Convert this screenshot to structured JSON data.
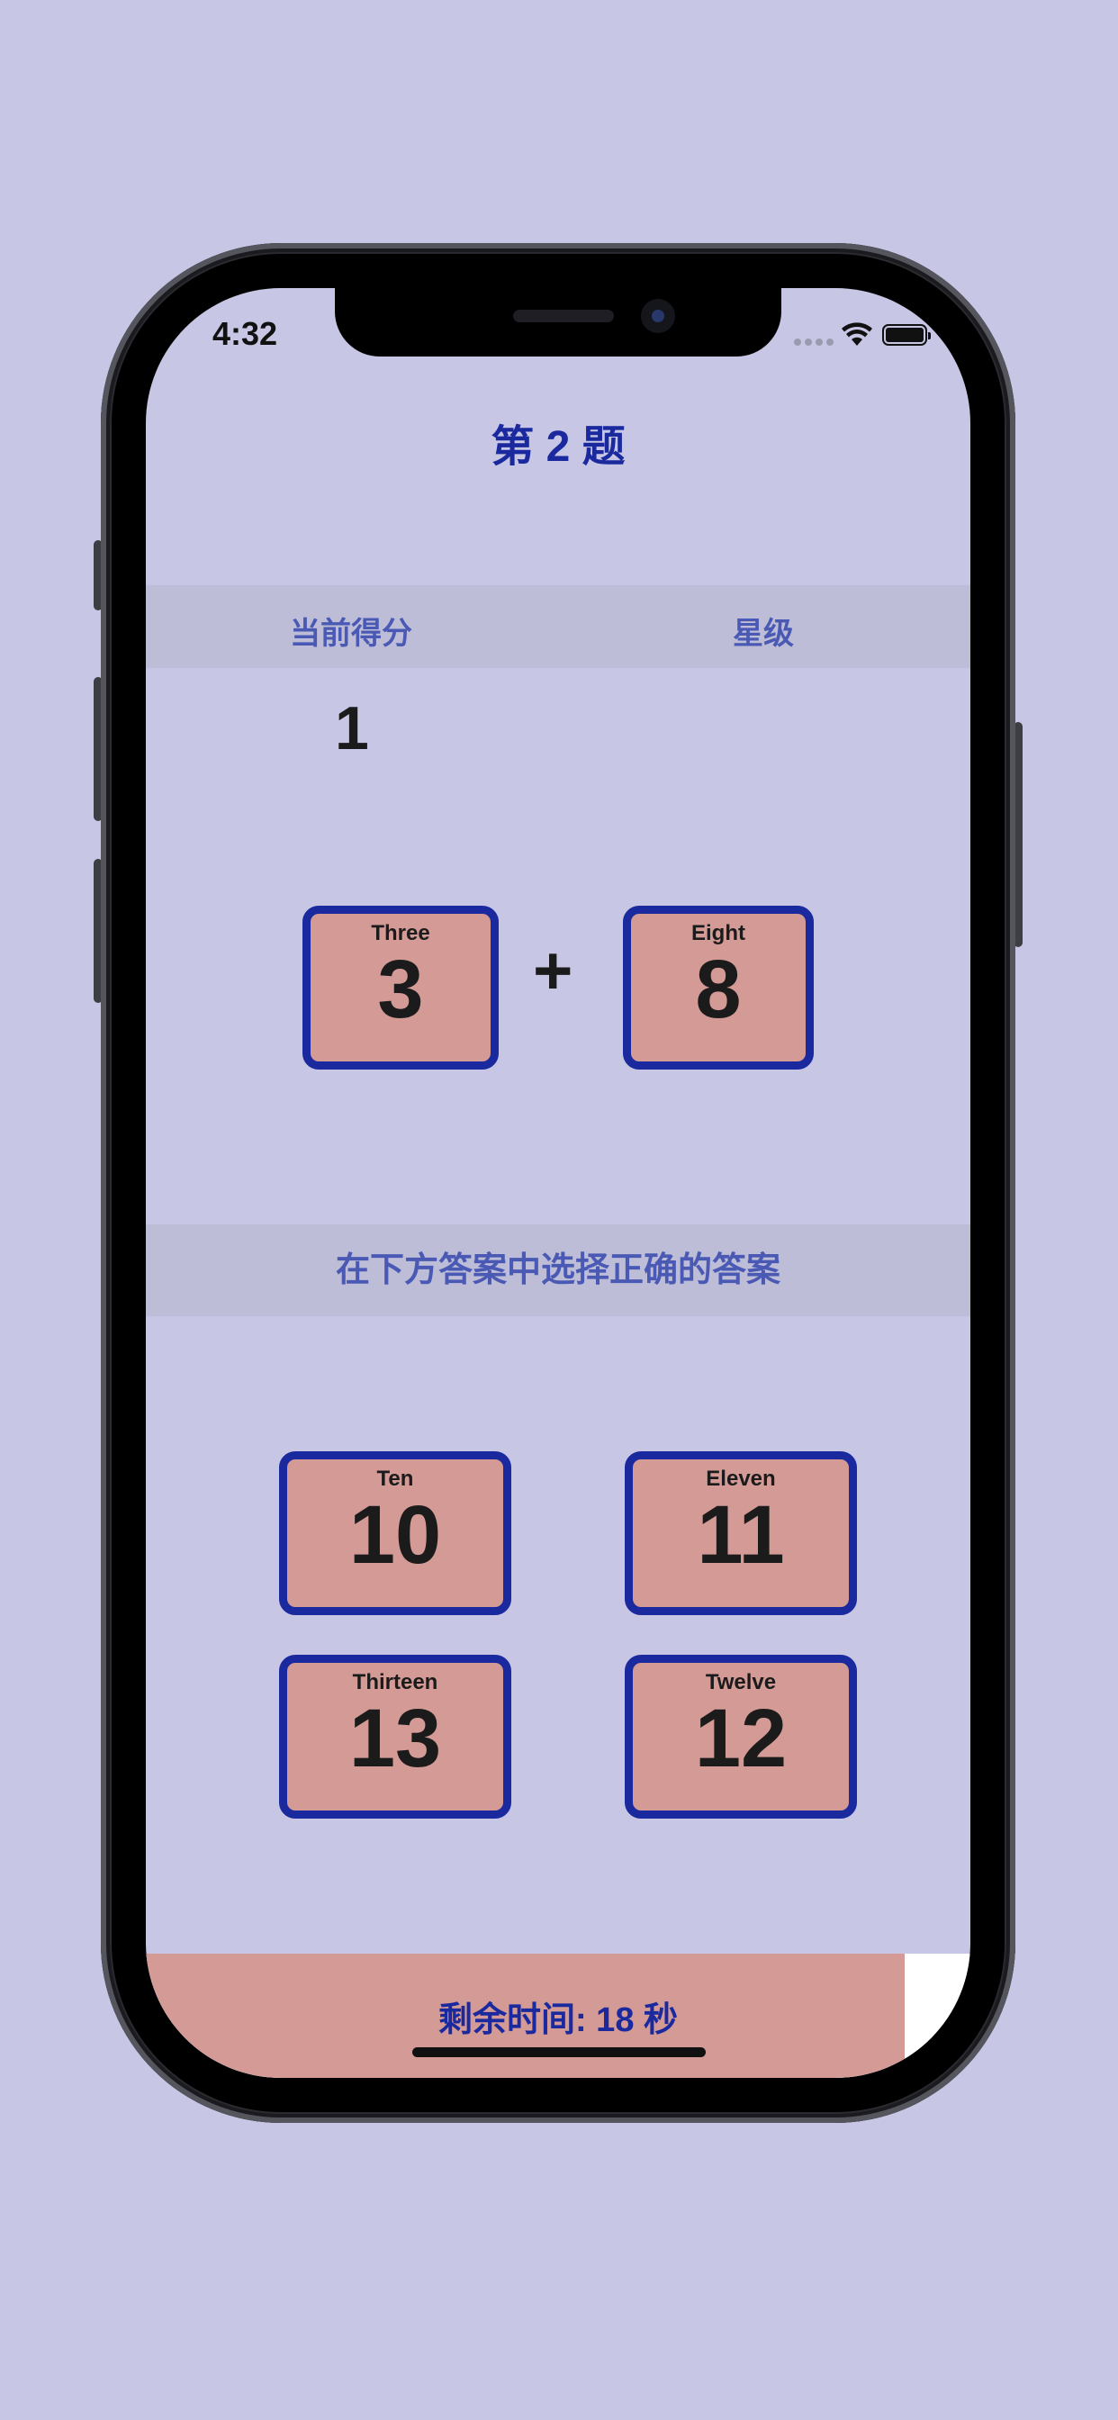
{
  "status_bar": {
    "time": "4:32"
  },
  "header": {
    "title": "第 2 题"
  },
  "score_section": {
    "score_label": "当前得分",
    "stars_label": "星级",
    "score_value": "1"
  },
  "question": {
    "operator": "+",
    "left_card": {
      "word": "Three",
      "number": "3"
    },
    "right_card": {
      "word": "Eight",
      "number": "8"
    }
  },
  "prompt": {
    "text": "在下方答案中选择正确的答案"
  },
  "answers": [
    {
      "word": "Ten",
      "number": "10"
    },
    {
      "word": "Eleven",
      "number": "11"
    },
    {
      "word": "Thirteen",
      "number": "13"
    },
    {
      "word": "Twelve",
      "number": "12"
    }
  ],
  "timer": {
    "text": "剩余时间: 18 秒",
    "remaining_fraction": 0.92
  },
  "colors": {
    "background": "#c7c7e5",
    "accent_blue": "#1a2a9e",
    "label_blue": "#4a5ab4",
    "card_fill": "#d49a96"
  }
}
